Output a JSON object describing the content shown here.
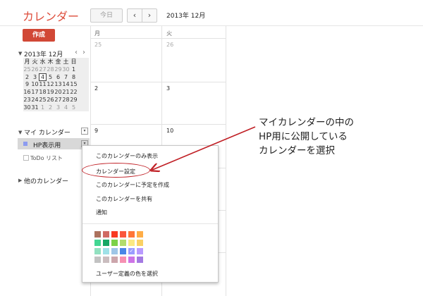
{
  "header": {
    "app_title": "カレンダー",
    "today_label": "今日",
    "prev_icon": "‹",
    "next_icon": "›",
    "date_range": "2013年 12月"
  },
  "sidebar": {
    "create_label": "作成",
    "mini_cal": {
      "title": "2013年 12月",
      "prev": "‹",
      "next": "›",
      "dow": [
        "月",
        "火",
        "水",
        "木",
        "金",
        "土",
        "日"
      ],
      "weeks": [
        [
          "25",
          "26",
          "27",
          "28",
          "29",
          "30",
          "1"
        ],
        [
          "2",
          "3",
          "4",
          "5",
          "6",
          "7",
          "8"
        ],
        [
          "9",
          "10",
          "11",
          "12",
          "13",
          "14",
          "15"
        ],
        [
          "16",
          "17",
          "18",
          "19",
          "20",
          "21",
          "22"
        ],
        [
          "23",
          "24",
          "25",
          "26",
          "27",
          "28",
          "29"
        ],
        [
          "30",
          "31",
          "1",
          "2",
          "3",
          "4",
          "5"
        ]
      ],
      "selected": "4"
    },
    "my_calendars_label": "マイ カレンダー",
    "calendar_item": "HP表示用",
    "calendar_color": "#8c9bf0",
    "todo_label": "ToDo リスト",
    "other_calendars_label": "他のカレンダー",
    "dropdown_glyph": "▾"
  },
  "grid": {
    "day_headers": [
      "月",
      "火"
    ],
    "rows": [
      [
        "25",
        "26"
      ],
      [
        "2",
        "3"
      ],
      [
        "9",
        "10"
      ]
    ]
  },
  "menu": {
    "items": [
      "このカレンダーのみ表示",
      "カレンダー設定",
      "このカレンダーに予定を作成",
      "このカレンダーを共有",
      "通知"
    ],
    "custom_color_label": "ユーザー定義の色を選択",
    "colors": [
      [
        "#ac725e",
        "#d06b64",
        "#f83a22",
        "#fa573c",
        "#ff7537",
        "#ffad46"
      ],
      [
        "#42d692",
        "#16a765",
        "#7bd148",
        "#b3dc6c",
        "#fbe983",
        "#fad165"
      ],
      [
        "#92e1c0",
        "#9fe1e7",
        "#9fc6e7",
        "#4986e7",
        "#9a9cff",
        "#b99aff"
      ],
      [
        "#c2c2c2",
        "#cabdbf",
        "#cca6ac",
        "#f691b2",
        "#cd74e6",
        "#a47ae2"
      ]
    ],
    "selected_color": "#9a9cff",
    "check_glyph": "✓"
  },
  "annotation": {
    "lines": [
      "マイカレンダーの中の",
      "HP用に公開している",
      "カレンダーを選択"
    ],
    "color": "#c01f25"
  }
}
